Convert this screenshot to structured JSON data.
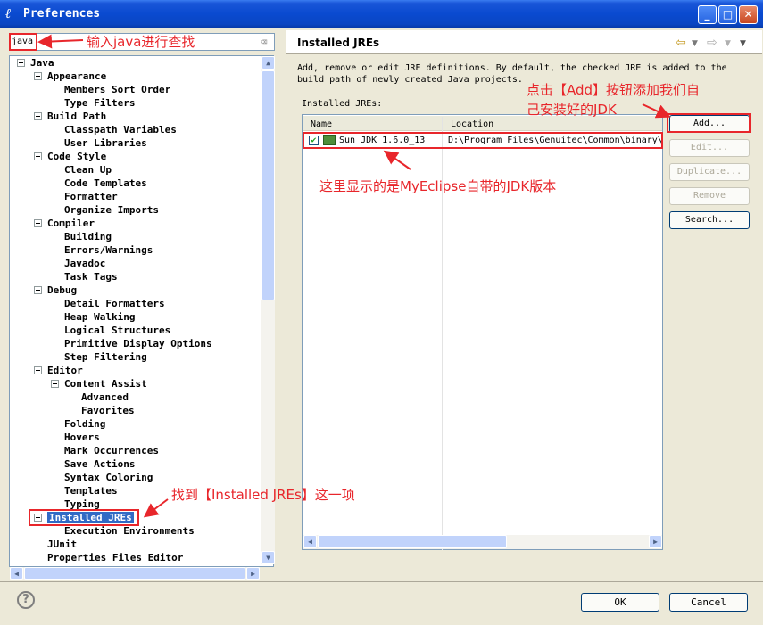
{
  "window": {
    "title": "Preferences"
  },
  "search": {
    "value": "java",
    "clear_icon": "⌫"
  },
  "tree": [
    {
      "label": "Java",
      "level": 0,
      "expanded": true
    },
    {
      "label": "Appearance",
      "level": 1,
      "expanded": true
    },
    {
      "label": "Members Sort Order",
      "level": 2
    },
    {
      "label": "Type Filters",
      "level": 2
    },
    {
      "label": "Build Path",
      "level": 1,
      "expanded": true
    },
    {
      "label": "Classpath Variables",
      "level": 2
    },
    {
      "label": "User Libraries",
      "level": 2
    },
    {
      "label": "Code Style",
      "level": 1,
      "expanded": true
    },
    {
      "label": "Clean Up",
      "level": 2
    },
    {
      "label": "Code Templates",
      "level": 2
    },
    {
      "label": "Formatter",
      "level": 2
    },
    {
      "label": "Organize Imports",
      "level": 2
    },
    {
      "label": "Compiler",
      "level": 1,
      "expanded": true
    },
    {
      "label": "Building",
      "level": 2
    },
    {
      "label": "Errors/Warnings",
      "level": 2
    },
    {
      "label": "Javadoc",
      "level": 2
    },
    {
      "label": "Task Tags",
      "level": 2
    },
    {
      "label": "Debug",
      "level": 1,
      "expanded": true
    },
    {
      "label": "Detail Formatters",
      "level": 2
    },
    {
      "label": "Heap Walking",
      "level": 2
    },
    {
      "label": "Logical Structures",
      "level": 2
    },
    {
      "label": "Primitive Display Options",
      "level": 2
    },
    {
      "label": "Step Filtering",
      "level": 2
    },
    {
      "label": "Editor",
      "level": 1,
      "expanded": true
    },
    {
      "label": "Content Assist",
      "level": 2,
      "expanded": true
    },
    {
      "label": "Advanced",
      "level": 3
    },
    {
      "label": "Favorites",
      "level": 3
    },
    {
      "label": "Folding",
      "level": 2
    },
    {
      "label": "Hovers",
      "level": 2
    },
    {
      "label": "Mark Occurrences",
      "level": 2
    },
    {
      "label": "Save Actions",
      "level": 2
    },
    {
      "label": "Syntax Coloring",
      "level": 2
    },
    {
      "label": "Templates",
      "level": 2
    },
    {
      "label": "Typing",
      "level": 2
    },
    {
      "label": "Installed JREs",
      "level": 1,
      "expanded": true,
      "selected": true
    },
    {
      "label": "Execution Environments",
      "level": 2
    },
    {
      "label": "JUnit",
      "level": 1
    },
    {
      "label": "Properties Files Editor",
      "level": 1
    }
  ],
  "page": {
    "title": "Installed JREs",
    "description": "Add, remove or edit JRE definitions. By default, the checked JRE is added to the build path of newly created Java projects.",
    "installed_label": "Installed JREs:",
    "columns": [
      "Name",
      "Location"
    ],
    "rows": [
      {
        "name": "Sun JDK 1.6.0_13",
        "location": "D:\\Program Files\\Genuitec\\Common\\binary\\",
        "checked": true
      }
    ]
  },
  "buttons": {
    "add": "Add...",
    "edit": "Edit...",
    "duplicate": "Duplicate...",
    "remove": "Remove",
    "search": "Search...",
    "ok": "OK",
    "cancel": "Cancel"
  },
  "annotations": {
    "search_note": "输入java进行查找",
    "add_note_line1": "点击【Add】按钮添加我们自",
    "add_note_line2": "己安装好的JDK",
    "jdk_note": "这里显示的是MyEclipse自带的JDK版本",
    "jre_note": "找到【Installed JREs】这一项"
  },
  "colors": {
    "accent": "#316ac5",
    "annotation": "#e8262b",
    "titlebar": "#0a4ad0"
  }
}
